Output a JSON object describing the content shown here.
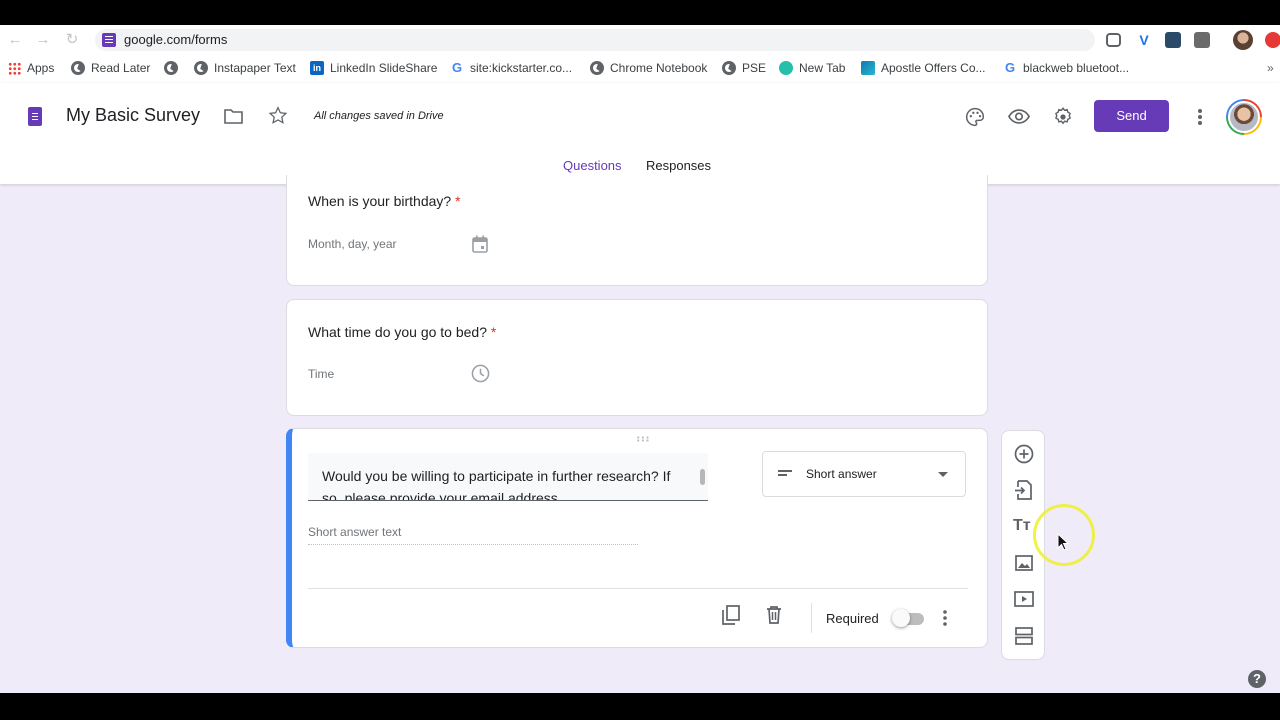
{
  "browser": {
    "url": "google.com/forms",
    "bookmarks": [
      {
        "label": "Apps",
        "icon": "apps-grid-icon"
      },
      {
        "label": "Read Later",
        "icon": "globe-icon"
      },
      {
        "label": "",
        "icon": "globe-icon"
      },
      {
        "label": "Instapaper Text",
        "icon": "globe-icon"
      },
      {
        "label": "LinkedIn SlideShare",
        "icon": "linkedin-icon"
      },
      {
        "label": "site:kickstarter.co...",
        "icon": "google-icon"
      },
      {
        "label": "Chrome Notebook",
        "icon": "globe-icon"
      },
      {
        "label": "PSE",
        "icon": "globe-icon"
      },
      {
        "label": "New Tab",
        "icon": "newtab-icon"
      },
      {
        "label": "Apostle Offers Co...",
        "icon": "apostle-icon"
      },
      {
        "label": "blackweb bluetoot...",
        "icon": "google-icon"
      }
    ],
    "overflow": "»"
  },
  "header": {
    "title": "My Basic Survey",
    "save_status": "All changes saved in Drive",
    "send_label": "Send",
    "brand_color": "#673ab7"
  },
  "tabs": [
    {
      "label": "Questions",
      "active": true
    },
    {
      "label": "Responses",
      "active": false
    }
  ],
  "questions": [
    {
      "title": "When is your birthday?",
      "required_mark": "*",
      "answer_placeholder": "Month, day, year",
      "icon": "calendar-icon"
    },
    {
      "title": "What time do you go to bed?",
      "required_mark": "*",
      "answer_placeholder": "Time",
      "icon": "clock-icon"
    }
  ],
  "active_question": {
    "text": "Would you be willing to participate in further research? If so, please provide your email address.",
    "type": "Short answer",
    "answer_placeholder": "Short answer text",
    "required_label": "Required",
    "required": false
  },
  "help": "?"
}
